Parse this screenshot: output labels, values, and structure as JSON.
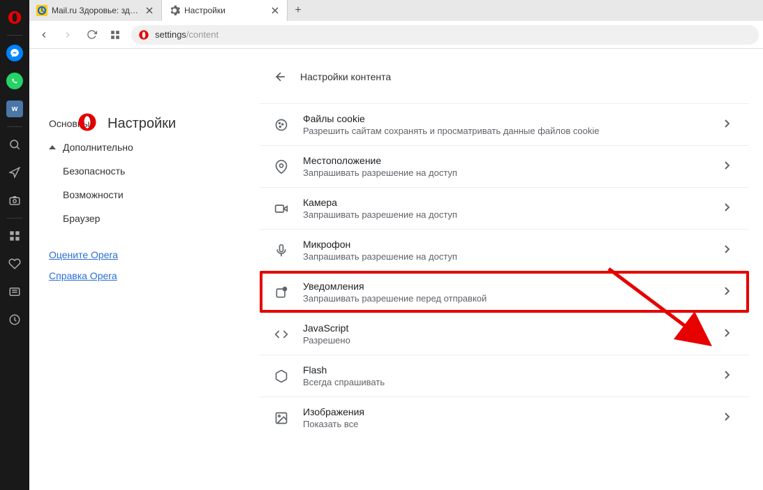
{
  "tabs": [
    {
      "label": "Mail.ru Здоровье: здоров",
      "favicon": "mailru"
    },
    {
      "label": "Настройки",
      "favicon": "gear"
    }
  ],
  "address": {
    "prefix": "settings",
    "suffix": "/content"
  },
  "settingsTitle": "Настройки",
  "contentTitle": "Настройки контента",
  "nav": {
    "main": "Основные",
    "advanced": "Дополнительно",
    "security": "Безопасность",
    "features": "Возможности",
    "browser": "Браузер",
    "rate": "Оцените Opera",
    "help": "Справка Opera"
  },
  "rows": [
    {
      "id": "cookies",
      "title": "Файлы cookie",
      "sub": "Разрешить сайтам сохранять и просматривать данные файлов cookie"
    },
    {
      "id": "location",
      "title": "Местоположение",
      "sub": "Запрашивать разрешение на доступ"
    },
    {
      "id": "camera",
      "title": "Камера",
      "sub": "Запрашивать разрешение на доступ"
    },
    {
      "id": "microphone",
      "title": "Микрофон",
      "sub": "Запрашивать разрешение на доступ"
    },
    {
      "id": "notifications",
      "title": "Уведомления",
      "sub": "Запрашивать разрешение перед отправкой"
    },
    {
      "id": "javascript",
      "title": "JavaScript",
      "sub": "Разрешено"
    },
    {
      "id": "flash",
      "title": "Flash",
      "sub": "Всегда спрашивать"
    },
    {
      "id": "images",
      "title": "Изображения",
      "sub": "Показать все"
    }
  ]
}
